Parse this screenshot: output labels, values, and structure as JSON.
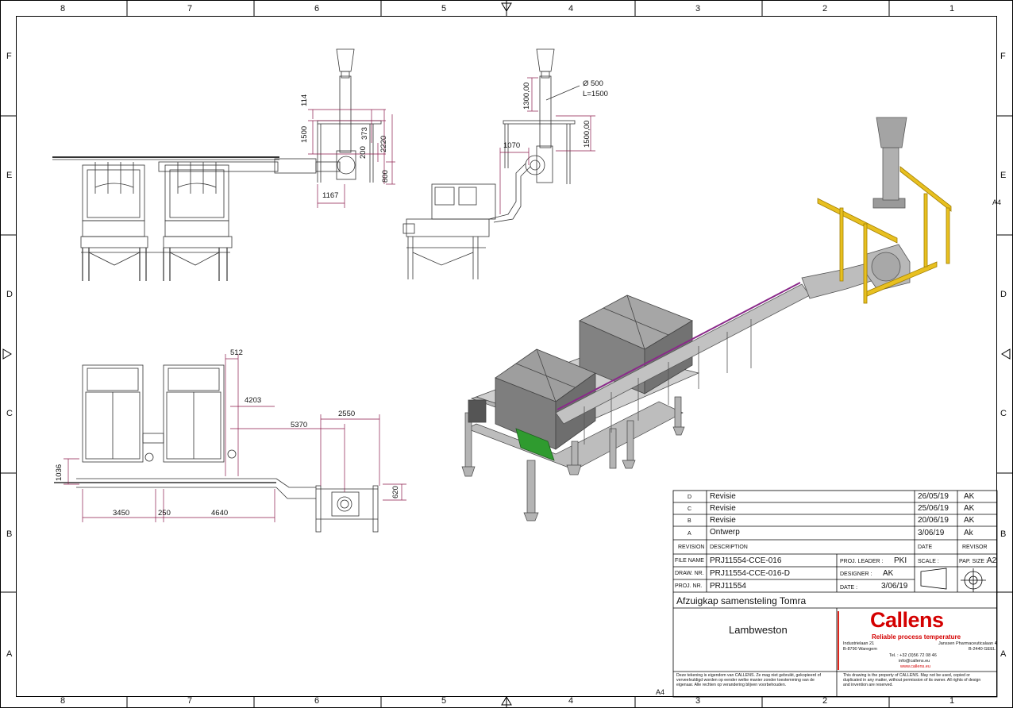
{
  "border": {
    "columns": [
      "8",
      "7",
      "6",
      "5",
      "4",
      "3",
      "2",
      "1"
    ],
    "rows": [
      "F",
      "E",
      "D",
      "C",
      "B",
      "A"
    ],
    "sheet_marker": "A4"
  },
  "dimensions": {
    "h114": "114",
    "h1500a": "1500",
    "h373": "373",
    "h200": "200",
    "h2220": "2220",
    "h800": "800",
    "w1167": "1167",
    "h1300": "1300,00",
    "pipe_d": "Ø 500",
    "pipe_l": "L=1500",
    "w1070": "1070",
    "h1500b": "1500,00",
    "w512": "512",
    "w4203": "4203",
    "w2550": "2550",
    "w5370": "5370",
    "h1036": "1036",
    "h620": "620",
    "w3450": "3450",
    "w250": "250",
    "w4640": "4640"
  },
  "title_block": {
    "revisions": [
      {
        "rev": "D",
        "desc": "Revisie",
        "date": "26/05/19",
        "by": "AK"
      },
      {
        "rev": "C",
        "desc": "Revisie",
        "date": "25/06/19",
        "by": "AK"
      },
      {
        "rev": "B",
        "desc": "Revisie",
        "date": "20/06/19",
        "by": "AK"
      },
      {
        "rev": "A",
        "desc": "Ontwerp",
        "date": "3/06/19",
        "by": "Ak"
      }
    ],
    "headers": {
      "revision": "REVISION",
      "description": "DESCRIPTION",
      "date": "DATE",
      "revisor": "REVISOR"
    },
    "file_name_label": "FILE NAME",
    "file_name": "PRJ11554-CCE-016",
    "draw_nr_label": "DRAW. NR.",
    "draw_nr": "PRJ11554-CCE-016-D",
    "proj_nr_label": "PROJ. NR.",
    "proj_nr": "PRJ11554",
    "proj_leader_label": "PROJ. LEADER :",
    "proj_leader": "PKI",
    "designer_label": "DESIGNER :",
    "designer": "AK",
    "date_label": "DATE :",
    "date": "3/06/19",
    "scale_label": "SCALE :",
    "pap_size_label": "PAP. SIZE :",
    "pap_size": "A2",
    "title": "Afzuigkap samensteling Tomra",
    "customer": "Lambweston",
    "company": {
      "logo": "Callens",
      "tagline": "Reliable process temperature",
      "addr1_l1": "Industrielaan 21",
      "addr1_l2": "B-8790 Waregem",
      "addr2_l1": "Janssen Pharmaceuticalaan 4",
      "addr2_l2": "B-2440 GEEL",
      "tel": "Tel. : +32 (0)56 72 08 46",
      "email": "info@callens.eu",
      "web": "www.callens.eu"
    },
    "notice_nl": "Deze tekening is eigendom van CALLENS. Ze mag niet gebruikt, gekopieerd of verveelvuldigd worden op eender welke manier zonder toestemming van de eigenaar. Alle rechten op verandering blijven voorbehouden.",
    "notice_en": "This drawing is the property of CALLENS. May not be used, copied or duplicated in any matter, without permission of its owner. All rights of design and invention are reserved."
  },
  "colors": {
    "dimension": "#8b1a4a",
    "logo_red": "#e1261c",
    "frame_yellow": "#e8c020",
    "motor_green": "#2f9b2f",
    "rail_purple": "#8a2a8a"
  }
}
